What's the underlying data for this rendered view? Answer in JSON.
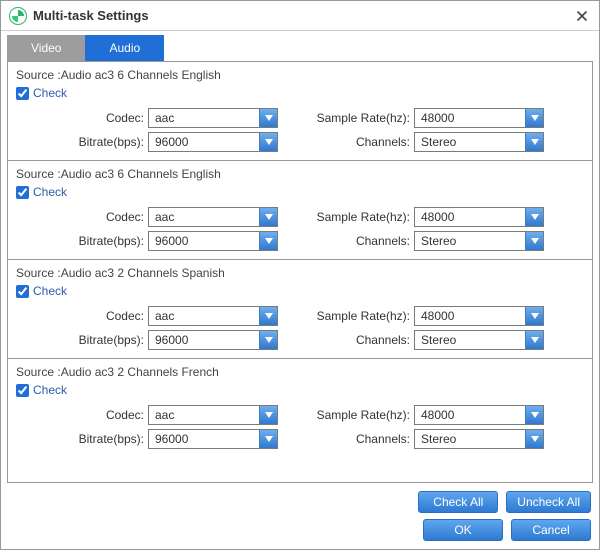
{
  "window": {
    "title": "Multi-task Settings"
  },
  "tabs": {
    "video": "Video",
    "audio": "Audio",
    "active": "audio"
  },
  "labels": {
    "check": "Check",
    "codec": "Codec:",
    "sample_rate": "Sample Rate(hz):",
    "bitrate": "Bitrate(bps):",
    "channels": "Channels:",
    "source_prefix": "Source :Audio"
  },
  "tracks": [
    {
      "source": "Source :Audio  ac3  6 Channels  English",
      "checked": true,
      "codec": "aac",
      "sample_rate": "48000",
      "bitrate": "96000",
      "channels": "Stereo"
    },
    {
      "source": "Source :Audio  ac3  6 Channels  English",
      "checked": true,
      "codec": "aac",
      "sample_rate": "48000",
      "bitrate": "96000",
      "channels": "Stereo"
    },
    {
      "source": "Source :Audio  ac3  2 Channels  Spanish",
      "checked": true,
      "codec": "aac",
      "sample_rate": "48000",
      "bitrate": "96000",
      "channels": "Stereo"
    },
    {
      "source": "Source :Audio  ac3  2 Channels  French",
      "checked": true,
      "codec": "aac",
      "sample_rate": "48000",
      "bitrate": "96000",
      "channels": "Stereo"
    }
  ],
  "buttons": {
    "check_all": "Check All",
    "uncheck_all": "Uncheck All",
    "ok": "OK",
    "cancel": "Cancel"
  },
  "colors": {
    "accent": "#1f6fd6",
    "tab_inactive": "#9d9d9d"
  }
}
